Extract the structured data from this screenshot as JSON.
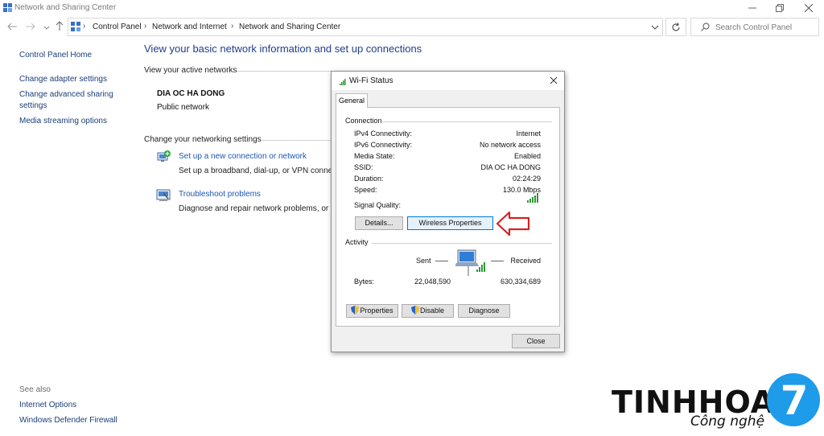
{
  "window": {
    "title": "Network and Sharing Center"
  },
  "address": {
    "crumbs": [
      "Control Panel",
      "Network and Internet",
      "Network and Sharing Center"
    ],
    "search_placeholder": "Search Control Panel"
  },
  "left_pane": {
    "home": "Control Panel Home",
    "links": [
      "Change adapter settings",
      "Change advanced sharing",
      "settings",
      "Media streaming options"
    ],
    "see_also_label": "See also",
    "see_also": [
      "Internet Options",
      "Windows Defender Firewall"
    ]
  },
  "main": {
    "title": "View your basic network information and set up connections",
    "active_networks_label": "View your active networks",
    "network_name": "DIA OC HA DONG",
    "network_type": "Public network",
    "change_settings_label": "Change your networking settings",
    "tasks": [
      {
        "link": "Set up a new connection or network",
        "desc": "Set up a broadband, dial-up, or VPN connect"
      },
      {
        "link": "Troubleshoot problems",
        "desc": "Diagnose and repair network problems, or g"
      }
    ]
  },
  "dialog": {
    "title": "Wi-Fi Status",
    "tab": "General",
    "connection_label": "Connection",
    "rows": [
      {
        "label": "IPv4 Connectivity:",
        "value": "Internet"
      },
      {
        "label": "IPv6 Connectivity:",
        "value": "No network access"
      },
      {
        "label": "Media State:",
        "value": "Enabled"
      },
      {
        "label": "SSID:",
        "value": "DIA OC HA DONG"
      },
      {
        "label": "Duration:",
        "value": "02:24:29"
      },
      {
        "label": "Speed:",
        "value": "130.0 Mbps"
      }
    ],
    "signal_label": "Signal Quality:",
    "details_button": "Details...",
    "wireless_button": "Wireless Properties",
    "activity_label": "Activity",
    "sent_label": "Sent",
    "received_label": "Received",
    "bytes_label": "Bytes:",
    "bytes_sent": "22,048,590",
    "bytes_received": "630,334,689",
    "properties_button": "Properties",
    "disable_button": "Disable",
    "diagnose_button": "Diagnose",
    "close_button": "Close"
  },
  "logo": {
    "name": "TINHHOA",
    "number": "7",
    "tagline": "Công nghệ"
  },
  "colors": {
    "link": "#1d56b3",
    "title": "#1e3f8a",
    "arrow": "#d42222",
    "logo_blue": "#1e9be9"
  }
}
